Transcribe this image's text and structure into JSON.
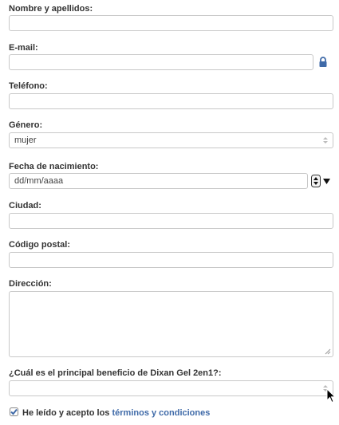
{
  "form": {
    "name_label": "Nombre y apellidos:",
    "email_label": "E-mail:",
    "phone_label": "Teléfono:",
    "gender_label": "Género:",
    "gender_value": "mujer",
    "birthdate_label": "Fecha de nacimiento:",
    "birthdate_placeholder": "dd/mm/aaaa",
    "city_label": "Ciudad:",
    "postal_label": "Código postal:",
    "address_label": "Dirección:",
    "benefit_label": "¿Cuál es el principal beneficio de Dixan Gel 2en1?:",
    "terms_prefix": "He leído y acepto los ",
    "terms_link": "términos y condiciones",
    "terms_checked": true
  },
  "colors": {
    "accent": "#3f6aa8",
    "checkbox": "#3f6aa8"
  },
  "icons": {
    "lock": "lock-icon",
    "select_arrows": "updown-arrows-icon",
    "spinner": "spinner-icon",
    "caret": "caret-down-icon",
    "cursor": "mouse-pointer-icon",
    "checkmark": "checkmark-icon",
    "resize": "resize-grip-icon"
  }
}
